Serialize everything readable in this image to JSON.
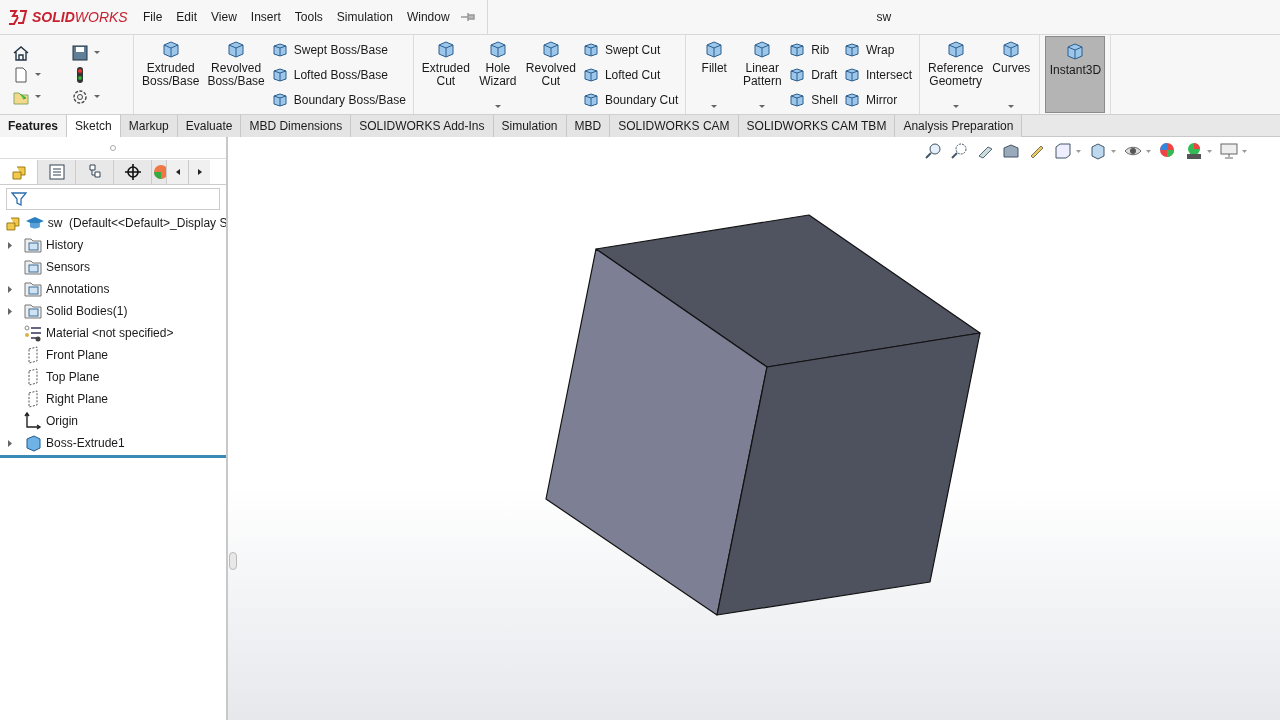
{
  "app": {
    "logo": "**SOLID**WORKS"
  },
  "menu": [
    "File",
    "Edit",
    "View",
    "Insert",
    "Tools",
    "Simulation",
    "Window"
  ],
  "window": {
    "title": "sw"
  },
  "ribbon": {
    "groups": [
      {
        "columns": [
          {
            "kind": "large",
            "label": "Extruded\nBoss/Base",
            "dropdown": false,
            "selected": false
          },
          {
            "kind": "large",
            "label": "Revolved\nBoss/Base",
            "dropdown": false,
            "selected": false
          },
          {
            "kind": "stack",
            "items": [
              "Swept Boss/Base",
              "Lofted Boss/Base",
              "Boundary Boss/Base"
            ]
          }
        ]
      },
      {
        "columns": [
          {
            "kind": "large",
            "label": "Extruded\nCut",
            "dropdown": false,
            "selected": false
          },
          {
            "kind": "large",
            "label": "Hole\nWizard",
            "dropdown": true,
            "selected": false
          },
          {
            "kind": "large",
            "label": "Revolved\nCut",
            "dropdown": false,
            "selected": false
          },
          {
            "kind": "stack",
            "items": [
              "Swept Cut",
              "Lofted Cut",
              "Boundary Cut"
            ]
          }
        ]
      },
      {
        "columns": [
          {
            "kind": "large",
            "label": "Fillet",
            "dropdown": true,
            "selected": false
          },
          {
            "kind": "large",
            "label": "Linear\nPattern",
            "dropdown": true,
            "selected": false
          },
          {
            "kind": "stack",
            "items": [
              "Rib",
              "Draft",
              "Shell"
            ]
          },
          {
            "kind": "stack",
            "items": [
              "Wrap",
              "Intersect",
              "Mirror"
            ]
          }
        ]
      },
      {
        "columns": [
          {
            "kind": "large",
            "label": "Reference\nGeometry",
            "dropdown": true,
            "selected": false
          },
          {
            "kind": "large",
            "label": "Curves",
            "dropdown": true,
            "selected": false
          }
        ]
      },
      {
        "columns": [
          {
            "kind": "large",
            "label": "Instant3D",
            "dropdown": false,
            "selected": true
          }
        ]
      }
    ]
  },
  "tabs": [
    {
      "label": "Features",
      "selected": true,
      "highlighted": false
    },
    {
      "label": "Sketch",
      "selected": false,
      "highlighted": true
    },
    {
      "label": "Markup",
      "selected": false,
      "highlighted": false
    },
    {
      "label": "Evaluate",
      "selected": false,
      "highlighted": false
    },
    {
      "label": "MBD Dimensions",
      "selected": false,
      "highlighted": false
    },
    {
      "label": "SOLIDWORKS Add-Ins",
      "selected": false,
      "highlighted": false
    },
    {
      "label": "Simulation",
      "selected": false,
      "highlighted": false
    },
    {
      "label": "MBD",
      "selected": false,
      "highlighted": false
    },
    {
      "label": "SOLIDWORKS CAM",
      "selected": false,
      "highlighted": false
    },
    {
      "label": "SOLIDWORKS CAM TBM",
      "selected": false,
      "highlighted": false
    },
    {
      "label": "Analysis Preparation",
      "selected": false,
      "highlighted": false
    }
  ],
  "panel_tabs": [
    {
      "selected": true
    },
    {
      "selected": false
    },
    {
      "selected": false
    },
    {
      "selected": false
    }
  ],
  "tree": {
    "root": "sw  (Default<<Default>_Display S",
    "items": [
      {
        "label": "History",
        "kind": "folder",
        "expandable": true
      },
      {
        "label": "Sensors",
        "kind": "folder",
        "expandable": false
      },
      {
        "label": "Annotations",
        "kind": "folder",
        "expandable": true
      },
      {
        "label": "Solid Bodies(1)",
        "kind": "folder",
        "expandable": true
      },
      {
        "label": "Material <not specified>",
        "kind": "material",
        "expandable": false
      },
      {
        "label": "Front Plane",
        "kind": "plane",
        "expandable": false
      },
      {
        "label": "Top Plane",
        "kind": "plane",
        "expandable": false
      },
      {
        "label": "Right Plane",
        "kind": "plane",
        "expandable": false
      },
      {
        "label": "Origin",
        "kind": "origin",
        "expandable": false
      },
      {
        "label": "Boss-Extrude1",
        "kind": "feature",
        "expandable": true
      }
    ]
  }
}
